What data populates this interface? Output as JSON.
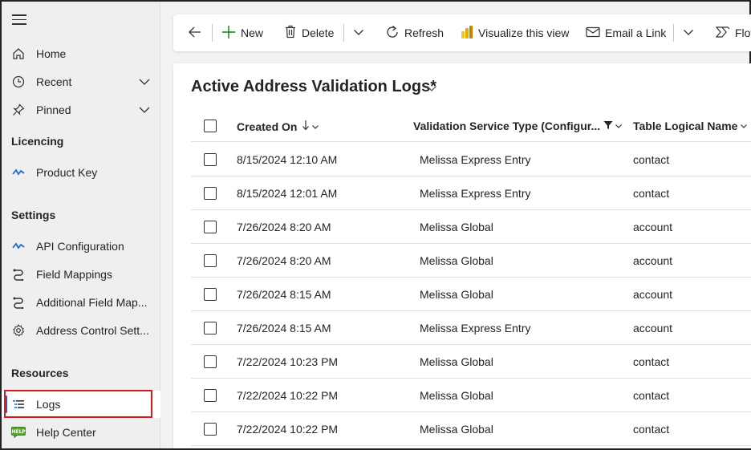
{
  "sidebar": {
    "items": [
      {
        "label": "Home",
        "icon": "home-icon"
      },
      {
        "label": "Recent",
        "icon": "clock-icon"
      },
      {
        "label": "Pinned",
        "icon": "pin-icon"
      }
    ],
    "sections": {
      "licencing": {
        "title": "Licencing",
        "items": [
          {
            "label": "Product Key",
            "icon": "key-wave-icon"
          }
        ]
      },
      "settings": {
        "title": "Settings",
        "items": [
          {
            "label": "API Configuration",
            "icon": "api-wave-icon"
          },
          {
            "label": "Field Mappings",
            "icon": "mapping-icon"
          },
          {
            "label": "Additional Field Map...",
            "icon": "mapping-icon"
          },
          {
            "label": "Address Control Sett...",
            "icon": "gear-icon"
          }
        ]
      },
      "resources": {
        "title": "Resources",
        "items": [
          {
            "label": "Logs",
            "icon": "logs-icon"
          },
          {
            "label": "Help Center",
            "icon": "help-icon"
          }
        ]
      }
    },
    "accent_color": "#0f6cbd",
    "highlight_color": "#d71a1a"
  },
  "toolbar": {
    "new_label": "New",
    "delete_label": "Delete",
    "refresh_label": "Refresh",
    "visualize_label": "Visualize this view",
    "email_label": "Email a Link",
    "flow_label": "Flow"
  },
  "view": {
    "title": "Active Address Validation Logs*",
    "columns": [
      "Created On",
      "Validation Service Type (Configur...",
      "Table Logical Name"
    ],
    "rows": [
      [
        "8/15/2024 12:10 AM",
        "Melissa Express Entry",
        "contact"
      ],
      [
        "8/15/2024 12:01 AM",
        "Melissa Express Entry",
        "contact"
      ],
      [
        "7/26/2024 8:20 AM",
        "Melissa Global",
        "account"
      ],
      [
        "7/26/2024 8:20 AM",
        "Melissa Global",
        "account"
      ],
      [
        "7/26/2024 8:15 AM",
        "Melissa Global",
        "account"
      ],
      [
        "7/26/2024 8:15 AM",
        "Melissa Express Entry",
        "account"
      ],
      [
        "7/22/2024 10:23 PM",
        "Melissa Global",
        "contact"
      ],
      [
        "7/22/2024 10:22 PM",
        "Melissa Global",
        "contact"
      ],
      [
        "7/22/2024 10:22 PM",
        "Melissa Global",
        "contact"
      ]
    ]
  }
}
